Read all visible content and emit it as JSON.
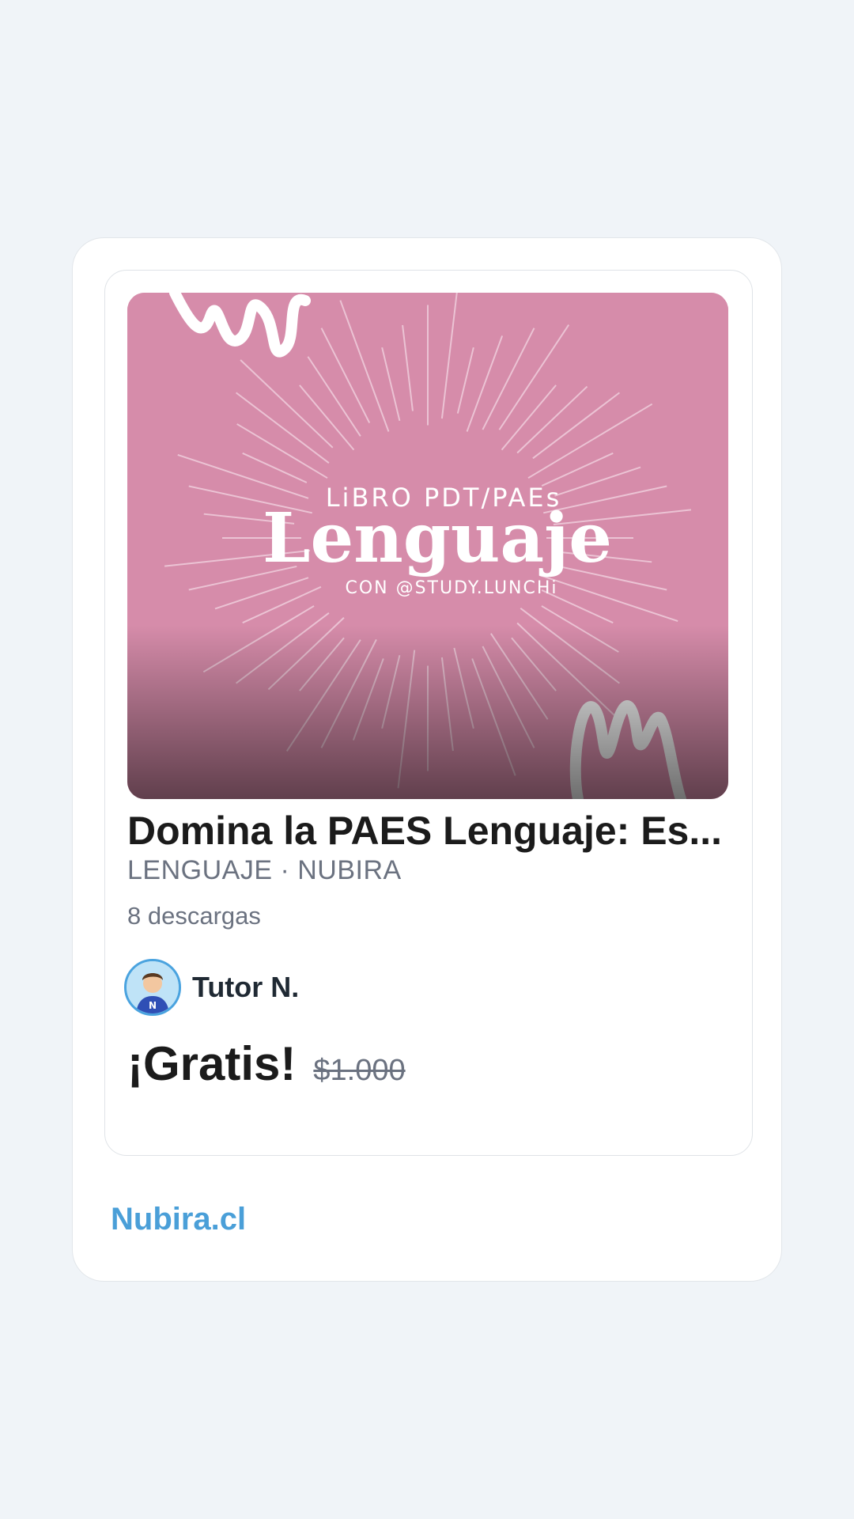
{
  "product": {
    "cover": {
      "top_line": "LiBRO PDT/PAEs",
      "main_word": "Lenguaje",
      "bottom_line": "CON @STUDY.LUNCHi",
      "background_color": "#d68caa"
    },
    "title": "Domina la PAES Lenguaje: Es...",
    "meta": "LENGUAJE · NUBIRA",
    "downloads": "8 descargas",
    "author": {
      "name": "Tutor N.",
      "avatar_icon": "tutor-avatar"
    },
    "price": "¡Gratis!",
    "old_price": "$1.000"
  },
  "footer": {
    "site_link": "Nubira.cl",
    "link_color": "#4a9fd8"
  }
}
